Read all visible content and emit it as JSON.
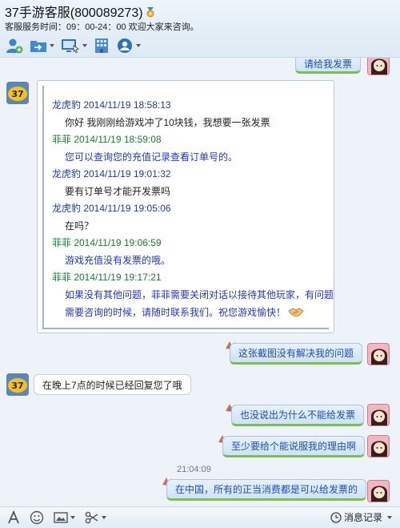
{
  "header": {
    "title": "37手游客服(800089273)",
    "subtitle": "客服服务时间：09：00-24：00 欢迎大家来咨询。",
    "toolbar": [
      "add-contact-icon",
      "send-file-icon",
      "remote-screen-icon",
      "app-grid-icon",
      "more-contacts-icon"
    ]
  },
  "messages": {
    "top_bubble": "请给我发票",
    "history": [
      {
        "head": "龙虎豹  2014/11/19 18:58:13",
        "msg": "你好  我刚刚给游戏冲了10块钱，我想要一张发票"
      },
      {
        "head": "菲菲  2014/11/19 18:59:08",
        "msg": "您可以查询您的充值记录查看订单号的。"
      },
      {
        "head": "龙虎豹  2014/11/19 19:01:32",
        "msg": "要有订单号才能开发票吗"
      },
      {
        "head": "龙虎豹  2014/11/19 19:05:06",
        "msg": "在吗？"
      },
      {
        "head": "菲菲  2014/11/19 19:06:59",
        "msg": "游戏充值没有发票的哦。"
      },
      {
        "head": "菲菲  2014/11/19 19:17:21",
        "msg": "如果没有其他问题，菲菲需要关闭对话以接待其他玩家，有问题",
        "msg2": "需要咨询的时候，请随时联系我们。祝您游戏愉快！"
      }
    ],
    "bubble_screenshot": "这张截图没有解决我的问题",
    "agent_reply": "在晚上7点的时候已经回复您了哦",
    "bubble_why": "也没说出为什么不能给发票",
    "bubble_reason": "至少要给个能说服我的理由啊",
    "timestamp": "21:04:09",
    "bubble_last": "在中国，所有的正当消费都是可以给发票的"
  },
  "bottombar": {
    "history_label": "消息记录"
  },
  "colors": {
    "my_bubble": "#cfe2f5",
    "my_text": "#1d4fb5",
    "agent_name": "#1f3d9c",
    "feifei_name": "#1a7b3a"
  }
}
